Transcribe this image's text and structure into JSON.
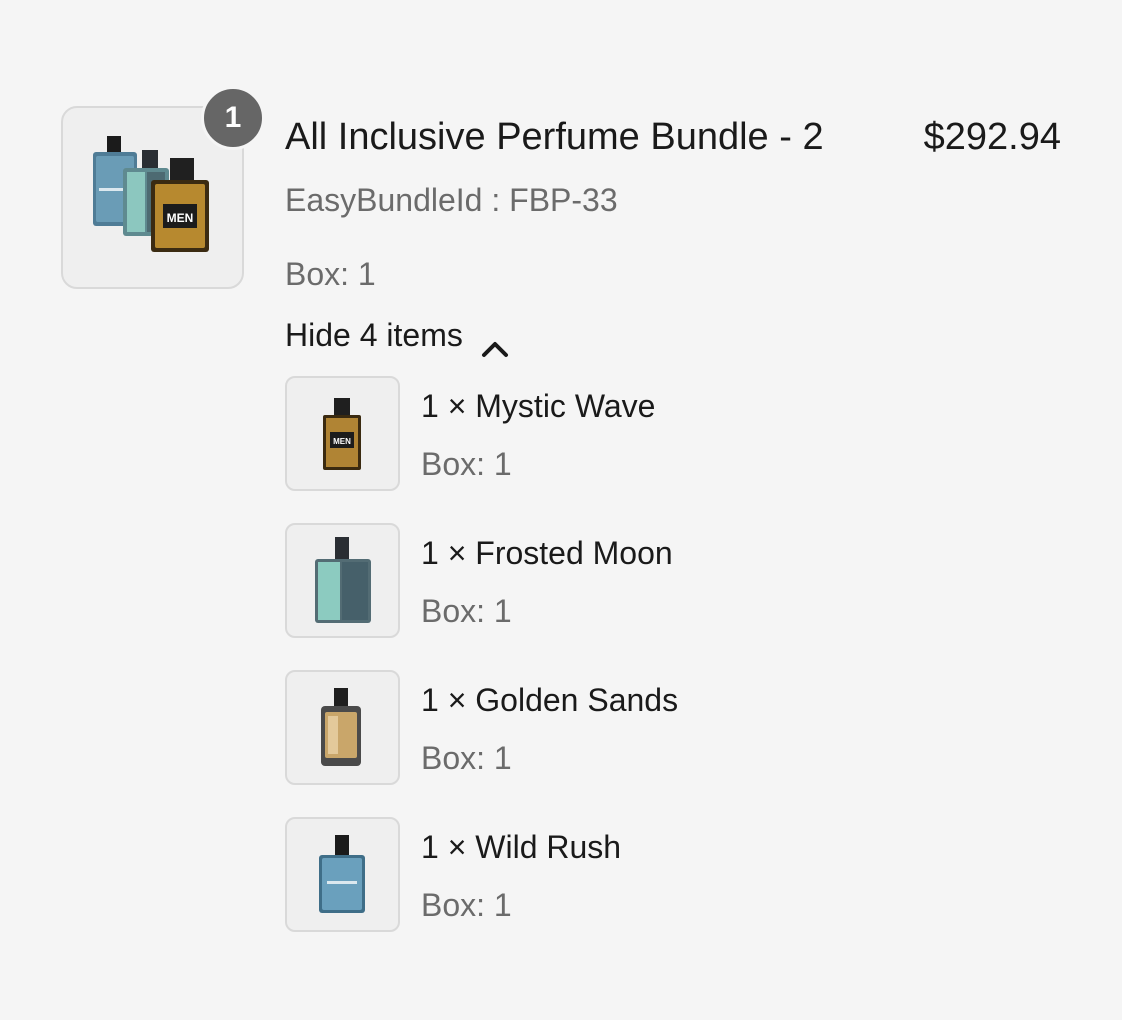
{
  "bundle": {
    "quantity_badge": "1",
    "title": "All Inclusive Perfume Bundle - 2",
    "price": "$292.94",
    "bundle_id": "EasyBundleId : FBP-33",
    "box": "Box: 1",
    "toggle_label": "Hide 4 items",
    "image_icon": "perfume-bundle-icon"
  },
  "items": [
    {
      "name": "1 × Mystic Wave",
      "box": "Box: 1",
      "image_icon": "gold-perfume-bottle-icon"
    },
    {
      "name": "1 × Frosted Moon",
      "box": "Box: 1",
      "image_icon": "teal-perfume-bottle-icon"
    },
    {
      "name": "1 × Golden Sands",
      "box": "Box: 1",
      "image_icon": "amber-perfume-bottle-icon"
    },
    {
      "name": "1 × Wild Rush",
      "box": "Box: 1",
      "image_icon": "blue-perfume-bottle-icon"
    }
  ],
  "colors": {
    "background": "#f5f5f5",
    "badge": "#666666",
    "muted_text": "#6b6b6b",
    "thumb_border": "#d9d9d9"
  }
}
